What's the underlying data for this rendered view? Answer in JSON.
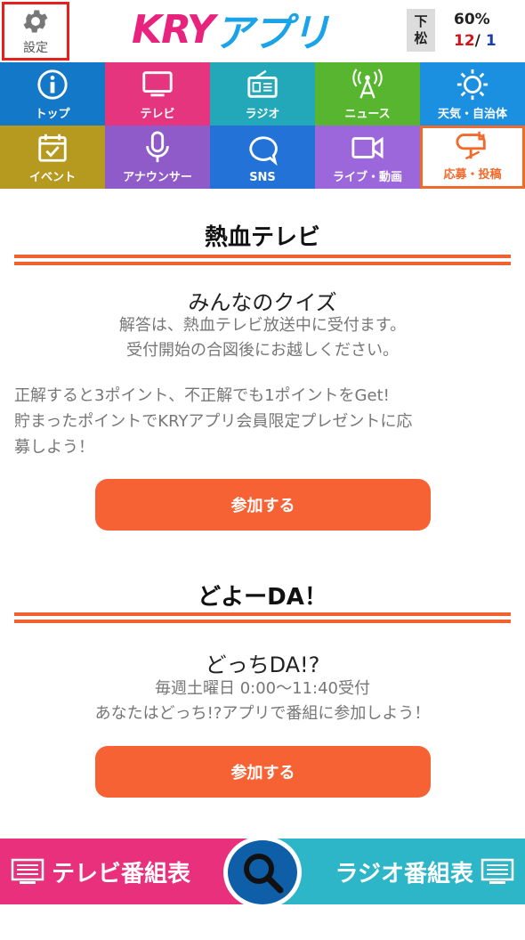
{
  "header": {
    "settings_label": "設定",
    "logo_kry": "KRY",
    "logo_app": "アプリ",
    "station_line1": "下",
    "station_line2": "松",
    "rain_percent": "60%",
    "temp_high": "12",
    "temp_sep": "/",
    "temp_low": "1"
  },
  "menu": [
    {
      "label": "トップ",
      "icon": "info-icon",
      "color": "#1478c8"
    },
    {
      "label": "テレビ",
      "icon": "tv-icon",
      "color": "#e5357f"
    },
    {
      "label": "ラジオ",
      "icon": "radio-icon",
      "color": "#22a8b8"
    },
    {
      "label": "ニュース",
      "icon": "news-antenna-icon",
      "color": "#57b52f"
    },
    {
      "label": "天気・自治体",
      "icon": "sun-icon",
      "color": "#1b8fe0"
    },
    {
      "label": "イベント",
      "icon": "calendar-icon",
      "color": "#b69a1f"
    },
    {
      "label": "アナウンサー",
      "icon": "microphone-icon",
      "color": "#8e5bc9"
    },
    {
      "label": "SNS",
      "icon": "chat-bubble-icon",
      "color": "#2272d8"
    },
    {
      "label": "ライブ・動画",
      "icon": "video-camera-icon",
      "color": "#9d67dc"
    },
    {
      "label": "応募・投稿",
      "icon": "mailbox-icon",
      "color": "#f06a2c"
    }
  ],
  "section1": {
    "title": "熱血テレビ",
    "item_title": "みんなのクイズ",
    "note_line1": "解答は、熱血テレビ放送中に受付ます。",
    "note_line2": "受付開始の合図後にお越しください。",
    "desc_line1": "正解すると3ポイント、不正解でも1ポイントをGet!",
    "desc_line2": "貯まったポイントでKRYアプリ会員限定プレゼントに応",
    "desc_line3": "募しよう！",
    "button_label": "参加する"
  },
  "section2": {
    "title": "どよーDA！",
    "item_title": "どっちDA!?",
    "note_line1": "毎週土曜日 0:00〜11:40受付",
    "note_line2": "あなたはどっち!?アプリで番組に参加しよう！",
    "button_label": "参加する"
  },
  "bottom": {
    "tv_label": "テレビ番組表",
    "radio_label": "ラジオ番組表"
  }
}
